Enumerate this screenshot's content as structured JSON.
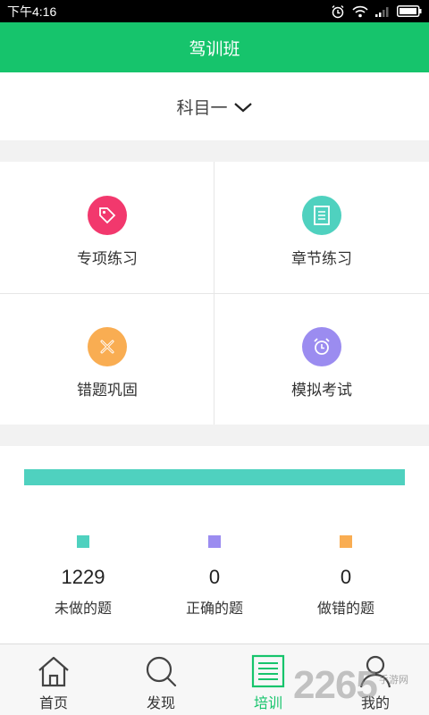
{
  "status_bar": {
    "time": "下午4:16"
  },
  "header": {
    "title": "驾训班"
  },
  "subject_selector": {
    "label": "科目一"
  },
  "practice": [
    {
      "label": "专项练习",
      "color": "#f2386d",
      "icon": "tag-icon"
    },
    {
      "label": "章节练习",
      "color": "#4fd1bf",
      "icon": "document-icon"
    },
    {
      "label": "错题巩固",
      "color": "#f9ad52",
      "icon": "cross-icon"
    },
    {
      "label": "模拟考试",
      "color": "#9b8cf0",
      "icon": "alarm-clock-icon"
    }
  ],
  "progress": {
    "unanswered_fraction": 1.0,
    "color": "#4fd1bf"
  },
  "stats": [
    {
      "value": "1229",
      "label": "未做的题",
      "color": "#4fd1bf"
    },
    {
      "value": "0",
      "label": "正确的题",
      "color": "#9b8cf0"
    },
    {
      "value": "0",
      "label": "做错的题",
      "color": "#f9ad52"
    }
  ],
  "tabs": [
    {
      "label": "首页",
      "icon": "home-icon"
    },
    {
      "label": "发现",
      "icon": "search-icon"
    },
    {
      "label": "培训",
      "icon": "list-icon",
      "active": true
    },
    {
      "label": "我的",
      "icon": "user-icon"
    }
  ],
  "watermark": {
    "number": "2265",
    "text": "手游网"
  },
  "colors": {
    "primary": "#16c46c"
  }
}
